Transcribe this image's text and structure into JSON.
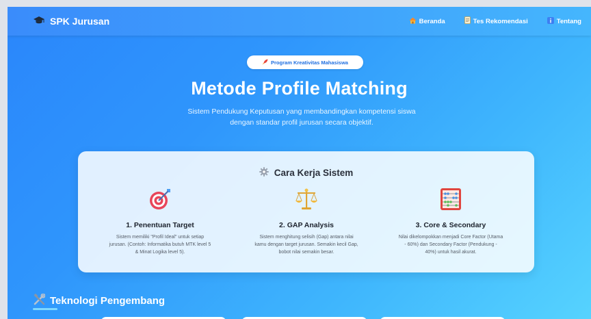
{
  "nav": {
    "brand": "SPK Jurusan",
    "brand_icon": "graduation-cap-icon",
    "links": [
      {
        "label": "Beranda",
        "icon": "home-icon"
      },
      {
        "label": "Tes Rekomendasi",
        "icon": "document-icon"
      },
      {
        "label": "Tentang",
        "icon": "info-icon"
      }
    ]
  },
  "hero": {
    "badge": "Program Kreativitas Mahasiswa",
    "badge_icon": "rocket-icon",
    "title": "Metode Profile Matching",
    "subtitle_line1": "Sistem Pendukung Keputusan yang membandingkan kompetensi siswa",
    "subtitle_line2": "dengan standar profil jurusan secara objektif."
  },
  "how": {
    "title": "Cara Kerja Sistem",
    "title_icon": "gear-icon",
    "steps": [
      {
        "icon": "target-icon",
        "title": "1. Penentuan Target",
        "desc_line1": "Sistem memiliki \"Profil Ideal\" untuk setiap",
        "desc_line2": "jurusan. (Contoh: Informatika butuh MTK level 5",
        "desc_line3": "& Minat Logika level 5)."
      },
      {
        "icon": "scale-icon",
        "title": "2. GAP Analysis",
        "desc_line1": "Sistem menghitung selisih (Gap) antara nilai",
        "desc_line2": "kamu dengan target jurusan. Semakin kecil Gap,",
        "desc_line3": "bobot nilai semakin besar."
      },
      {
        "icon": "abacus-icon",
        "title": "3. Core & Secondary",
        "desc_line1": "Nilai dikelompokkan menjadi Core Factor (Utama",
        "desc_line2": "- 60%) dan Secondary Factor (Pendukung -",
        "desc_line3": "40%) untuk hasil akurat."
      }
    ]
  },
  "tech": {
    "title": "Teknologi Pengembang",
    "icon": "tools-icon"
  },
  "colors": {
    "primary": "#2a86fb",
    "accent_light": "#56d3fe",
    "badge_text": "#1f6fe0"
  }
}
